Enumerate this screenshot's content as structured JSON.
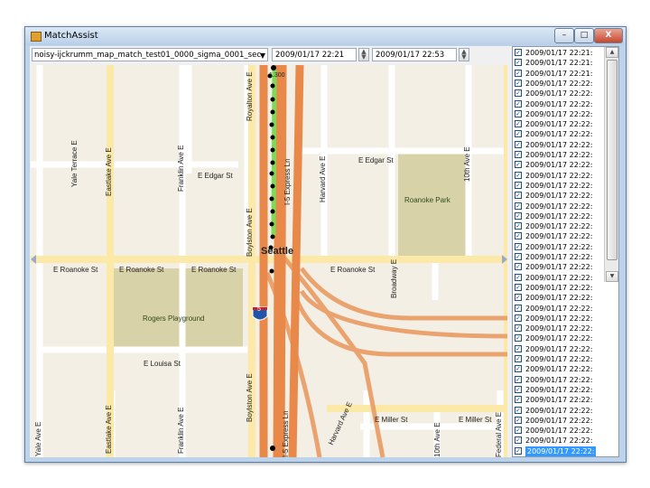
{
  "window": {
    "title": "MatchAssist",
    "buttons": {
      "minimize": "–",
      "maximize": "□",
      "close": "X"
    }
  },
  "toolbar": {
    "file_combo_value": "noisy-ijckrumm_map_match_test01_0000_sigma_0001_sec",
    "start_time": "2009/01/17 22:21",
    "end_time": "2009/01/17 22:53"
  },
  "map": {
    "city_label": "Seattle",
    "point_label": "1.300",
    "shield_label": "5",
    "labels": {
      "yale_terrace": "Yale Terrace E",
      "eastlake_top": "Eastlake Ave E",
      "franklin_top": "Franklin Ave E",
      "e_edgar_w": "E Edgar St",
      "royalton": "Royalton Ave E",
      "i5_express_top": "I-5 Express Ln",
      "harvard_top": "Harvard Ave E",
      "e_edgar_e": "E Edgar St",
      "tenth_top": "10th Ave E",
      "boylston_top": "Boylston Ave E",
      "roanoke_park": "Roanoke Park",
      "broadway": "Broadway E",
      "e_roanoke_1": "E Roanoke St",
      "e_roanoke_2": "E Roanoke St",
      "e_roanoke_3": "E Roanoke St",
      "e_roanoke_4": "E Roanoke St",
      "rogers": "Rogers Playground",
      "e_louisa": "E Louisa St",
      "yale_bottom": "Yale Ave E",
      "eastlake_bottom": "Eastlake Ave E",
      "franklin_bottom": "Franklin Ave E",
      "boylston_bottom": "Boylston Ave E",
      "i5_express_bottom": "I-5 Express Ln",
      "harvard_bottom": "Harvard Ave E",
      "e_miller_1": "E Miller St",
      "e_miller_2": "E Miller St",
      "tenth_bottom": "10th Ave E",
      "federal": "Federal Ave E"
    }
  },
  "timestamps": [
    "2009/01/17 22:21:",
    "2009/01/17 22:21:",
    "2009/01/17 22:21:",
    "2009/01/17 22:22:",
    "2009/01/17 22:22:",
    "2009/01/17 22:22:",
    "2009/01/17 22:22:",
    "2009/01/17 22:22:",
    "2009/01/17 22:22:",
    "2009/01/17 22:22:",
    "2009/01/17 22:22:",
    "2009/01/17 22:22:",
    "2009/01/17 22:22:",
    "2009/01/17 22:22:",
    "2009/01/17 22:22:",
    "2009/01/17 22:22:",
    "2009/01/17 22:22:",
    "2009/01/17 22:22:",
    "2009/01/17 22:22:",
    "2009/01/17 22:22:",
    "2009/01/17 22:22:",
    "2009/01/17 22:22:",
    "2009/01/17 22:22:",
    "2009/01/17 22:22:",
    "2009/01/17 22:22:",
    "2009/01/17 22:22:",
    "2009/01/17 22:22:",
    "2009/01/17 22:22:",
    "2009/01/17 22:22:",
    "2009/01/17 22:22:",
    "2009/01/17 22:22:",
    "2009/01/17 22:22:",
    "2009/01/17 22:22:",
    "2009/01/17 22:22:",
    "2009/01/17 22:22:",
    "2009/01/17 22:22:",
    "2009/01/17 22:22:",
    "2009/01/17 22:22:",
    "2009/01/17 22:22:",
    "2009/01/17 22:22:"
  ],
  "colors": {
    "map_background": "#f3efe5",
    "freeway": "#e8894a",
    "arterial": "#fce9a8",
    "park": "#d8d2a8",
    "matched_route": "#7ed957",
    "selection": "#3399ff"
  }
}
